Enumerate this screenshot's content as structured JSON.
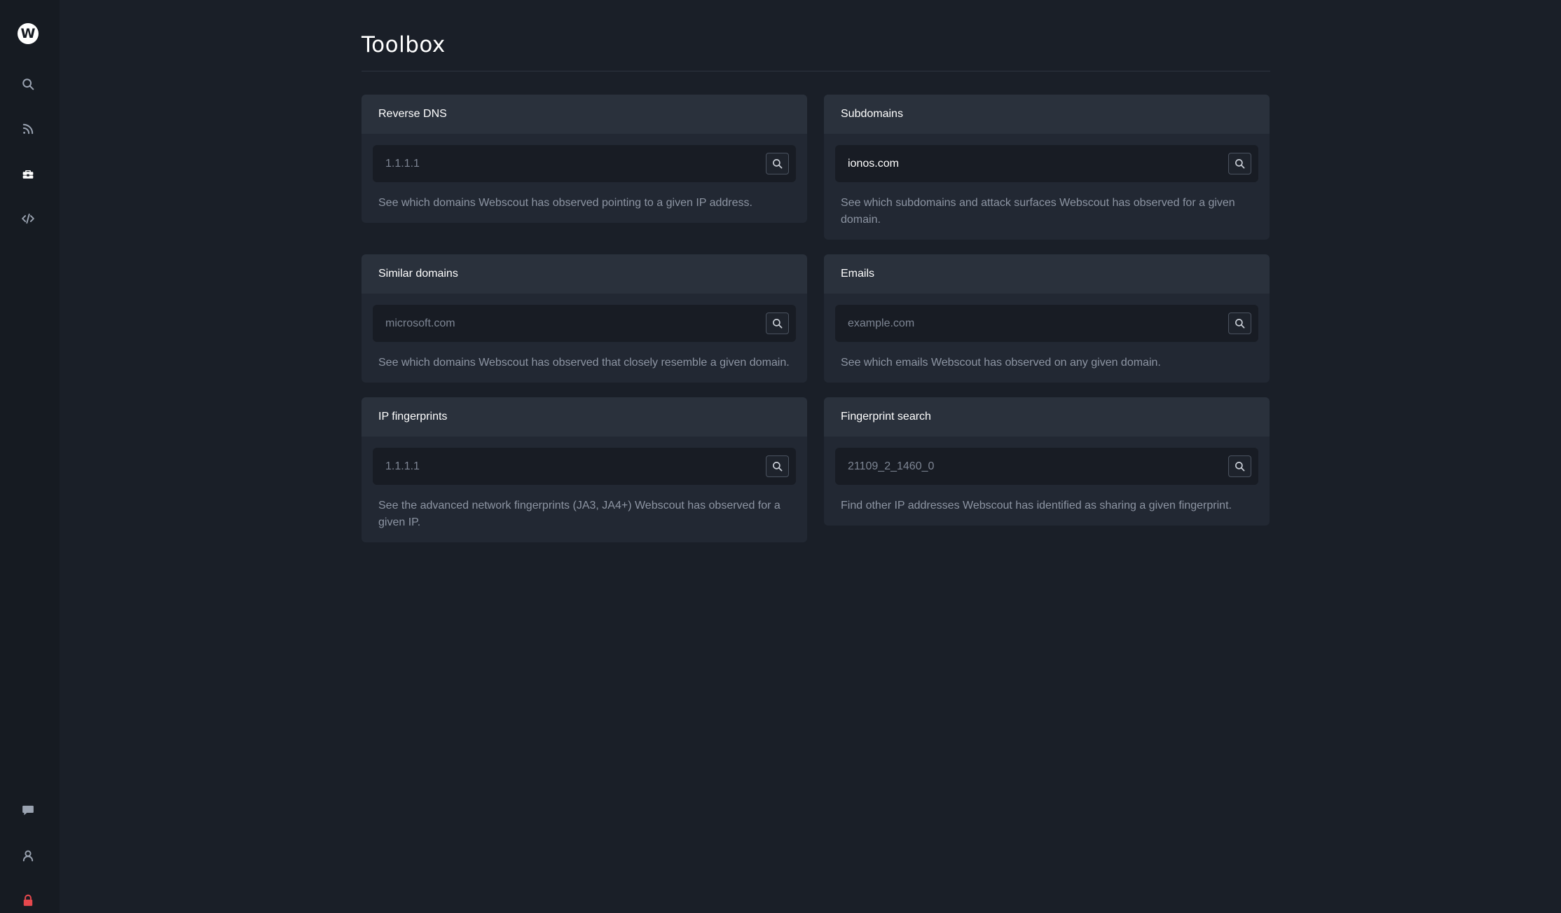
{
  "app": {
    "logo_letter": "W"
  },
  "sidebar": {
    "top_items": [
      {
        "icon": "search-icon"
      },
      {
        "icon": "rss-feed-icon"
      },
      {
        "icon": "toolbox-icon"
      },
      {
        "icon": "code-icon"
      }
    ],
    "bottom_items": [
      {
        "icon": "chat-icon"
      },
      {
        "icon": "user-icon"
      },
      {
        "icon": "lock-icon",
        "color": "#e5484d"
      }
    ],
    "icon_color": "#9aa3b1"
  },
  "page": {
    "title": "Toolbox"
  },
  "tools": [
    {
      "title": "Reverse DNS",
      "value": "",
      "placeholder": "1.1.1.1",
      "description": "See which domains Webscout has observed pointing to a given IP address."
    },
    {
      "title": "Subdomains",
      "value": "ionos.com",
      "placeholder": "",
      "description": "See which subdomains and attack surfaces Webscout has observed for a given domain."
    },
    {
      "title": "Similar domains",
      "value": "",
      "placeholder": "microsoft.com",
      "description": "See which domains Webscout has observed that closely resemble a given domain."
    },
    {
      "title": "Emails",
      "value": "",
      "placeholder": "example.com",
      "description": "See which emails Webscout has observed on any given domain."
    },
    {
      "title": "IP fingerprints",
      "value": "",
      "placeholder": "1.1.1.1",
      "description": "See the advanced network fingerprints (JA3, JA4+) Webscout has observed for a given IP."
    },
    {
      "title": "Fingerprint search",
      "value": "",
      "placeholder": "21109_2_1460_0",
      "description": "Find other IP addresses Webscout has identified as sharing a given fingerprint."
    }
  ],
  "colors": {
    "background": "#1a1f28",
    "sidebar": "#161b22",
    "card": "#222833",
    "card_header": "#2a313c",
    "input": "#181c24",
    "muted_text": "#8d95a3"
  }
}
